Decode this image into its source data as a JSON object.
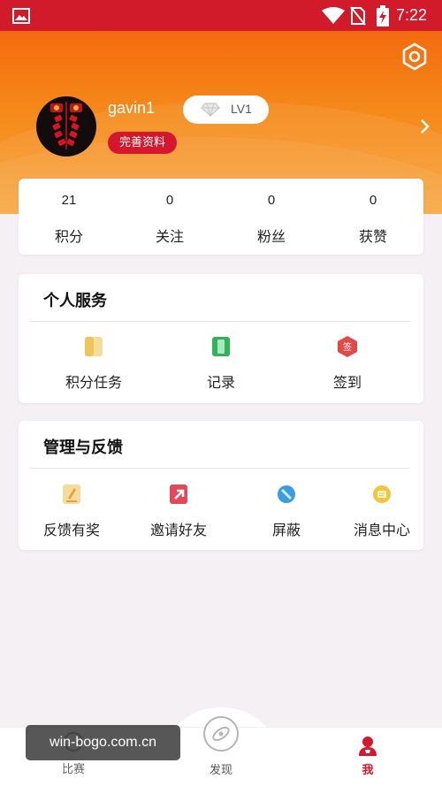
{
  "status_bar": {
    "time": "7:22",
    "icons": [
      "image-icon",
      "wifi-icon",
      "no-sim-icon",
      "battery-charging-icon"
    ]
  },
  "profile": {
    "username": "gavin1",
    "level": "LV1",
    "complete_profile_label": "完善资料",
    "icons": [
      "settings-icon",
      "diamond-icon",
      "chevron-right-icon"
    ]
  },
  "stats": [
    {
      "value": "21",
      "label": "积分"
    },
    {
      "value": "0",
      "label": "关注"
    },
    {
      "value": "0",
      "label": "粉丝"
    },
    {
      "value": "0",
      "label": "获赞"
    }
  ],
  "services": {
    "title": "个人服务",
    "items": [
      {
        "label": "积分任务",
        "icon": "points-task-icon"
      },
      {
        "label": "记录",
        "icon": "record-icon"
      },
      {
        "label": "签到",
        "icon": "checkin-icon",
        "icon_text": "签"
      }
    ]
  },
  "management": {
    "title": "管理与反馈",
    "items": [
      {
        "label": "反馈有奖",
        "icon": "feedback-icon"
      },
      {
        "label": "邀请好友",
        "icon": "invite-icon"
      },
      {
        "label": "屏蔽",
        "icon": "block-icon"
      },
      {
        "label": "消息中心",
        "icon": "message-icon"
      }
    ]
  },
  "bottom_nav": [
    {
      "label": "比赛",
      "icon": "match-icon"
    },
    {
      "label": "发现",
      "icon": "discover-icon"
    },
    {
      "label": "我",
      "icon": "profile-icon",
      "active": true
    }
  ],
  "watermark": "win-bogo.com.cn",
  "colors": {
    "status_bar": "#d11a2a",
    "header_orange": "#f36a0f",
    "accent_red": "#d4172c",
    "nav_active": "#d4172c",
    "record_green": "#2fb35a",
    "block_blue": "#3a9de0",
    "message_yellow": "#f4c43a"
  }
}
